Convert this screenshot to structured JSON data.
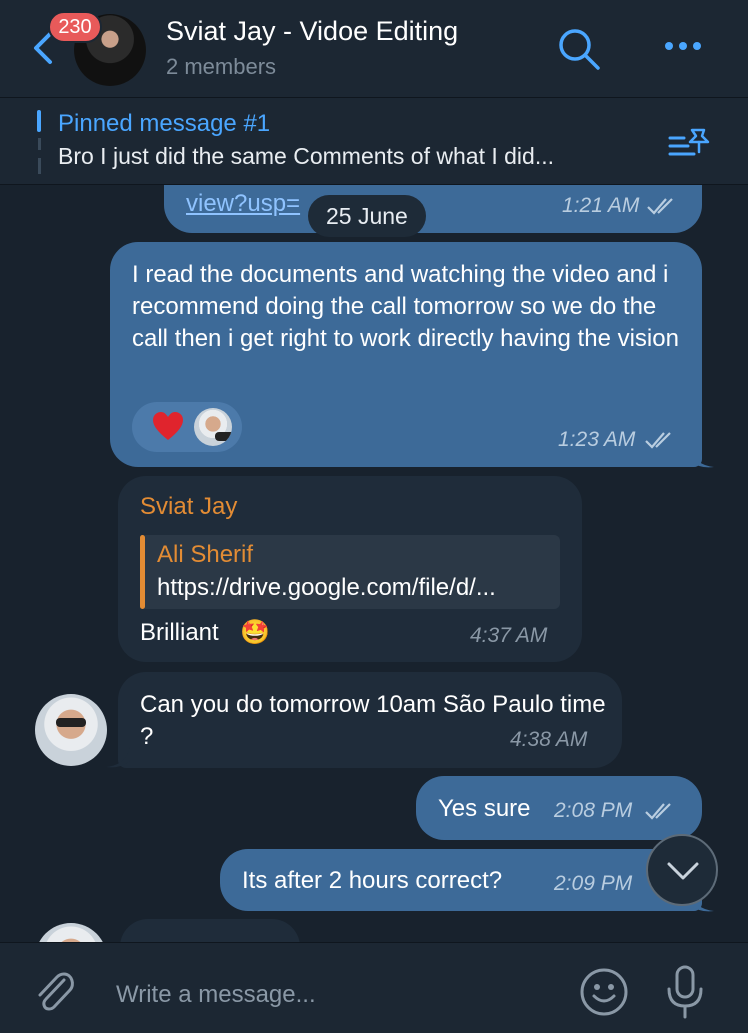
{
  "header": {
    "unread_count": "230",
    "title": "Sviat Jay - Vidoe Editing",
    "subtitle": "2 members"
  },
  "pinned": {
    "title": "Pinned message #1",
    "text": "Bro I just did the same Comments of what I did..."
  },
  "chat": {
    "date_label": "25 June",
    "messages": [
      {
        "direction": "outgoing",
        "text": "view?usp=",
        "time": "1:21 AM",
        "read": true
      },
      {
        "direction": "outgoing",
        "text": "I read the documents and watching the video and i recommend doing the call tomorrow so we do the call then i get right to work directly having the vision",
        "time": "1:23 AM",
        "read": true,
        "reactions": [
          "red-heart-emoji",
          "reactor-avatar"
        ]
      },
      {
        "direction": "incoming",
        "sender": "Sviat Jay",
        "reply": {
          "author": "Ali Sherif",
          "text": "https://drive.google.com/file/d/..."
        },
        "text": "Brilliant",
        "emoji": "🤩",
        "time": "4:37 AM"
      },
      {
        "direction": "incoming",
        "text": "Can you do tomorrow 10am São Paulo time ?",
        "time": "4:38 AM"
      },
      {
        "direction": "outgoing",
        "text": "Yes sure",
        "time": "2:08 PM",
        "read": true
      },
      {
        "direction": "outgoing",
        "text": "Its after 2 hours correct?",
        "time": "2:09 PM",
        "read": true
      }
    ]
  },
  "composer": {
    "placeholder": "Write a message..."
  },
  "colors": {
    "background": "#18222d",
    "bar": "#1c2733",
    "outgoing_bubble": "#3d6a98",
    "incoming_bubble": "#1f2c3a",
    "accent": "#4aa6ff",
    "sender_name": "#e38c34",
    "badge": "#e85a5a"
  }
}
